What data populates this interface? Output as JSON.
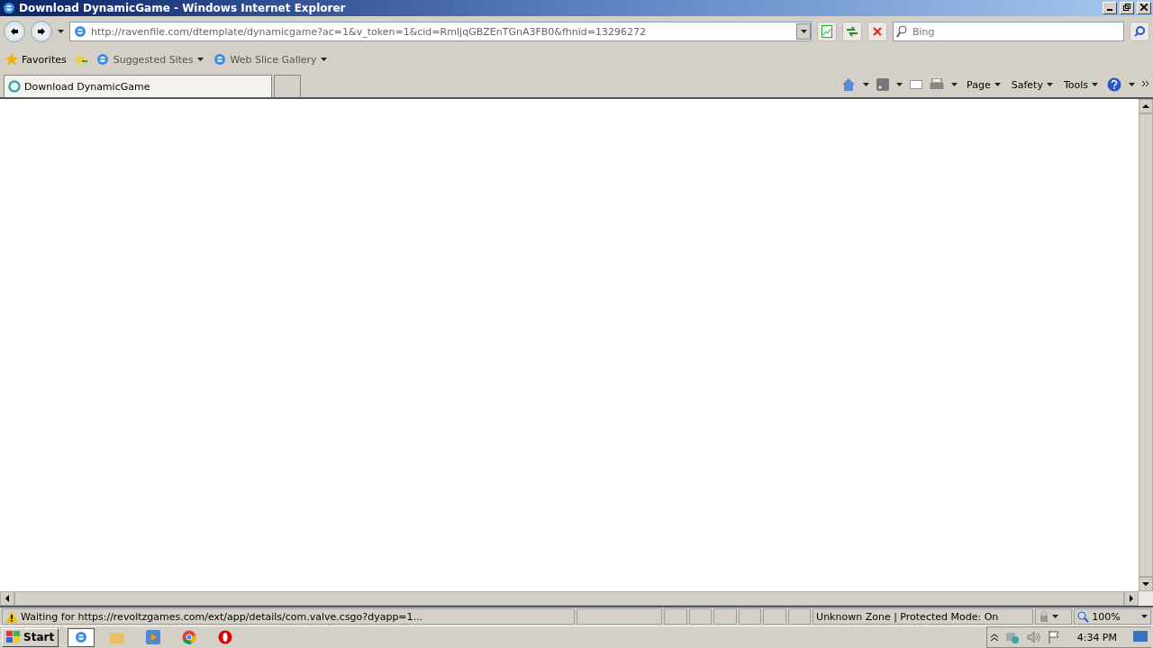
{
  "window": {
    "title": "Download DynamicGame - Windows Internet Explorer"
  },
  "address_bar": {
    "value": "http://ravenfile.com/dtemplate/dynamicgame?ac=1&v_token=1&cid=RmIjqGBZEnTGnA3FB0&fhnid=13296272"
  },
  "search": {
    "placeholder": "Bing"
  },
  "favorites_bar": {
    "favorites": "Favorites",
    "links": [
      "Suggested Sites",
      "Web Slice Gallery"
    ]
  },
  "tabs": [
    {
      "label": "Download DynamicGame",
      "selected": true
    }
  ],
  "command_bar": [
    "Page",
    "Safety",
    "Tools"
  ],
  "status_bar": {
    "message": "Waiting for https://revoltzgames.com/ext/app/details/com.valve.csgo?dyapp=1...",
    "zone": "Unknown Zone | Protected Mode: On",
    "zoom": "100%"
  },
  "taskbar": {
    "start": "Start",
    "clock": "4:34 PM"
  }
}
